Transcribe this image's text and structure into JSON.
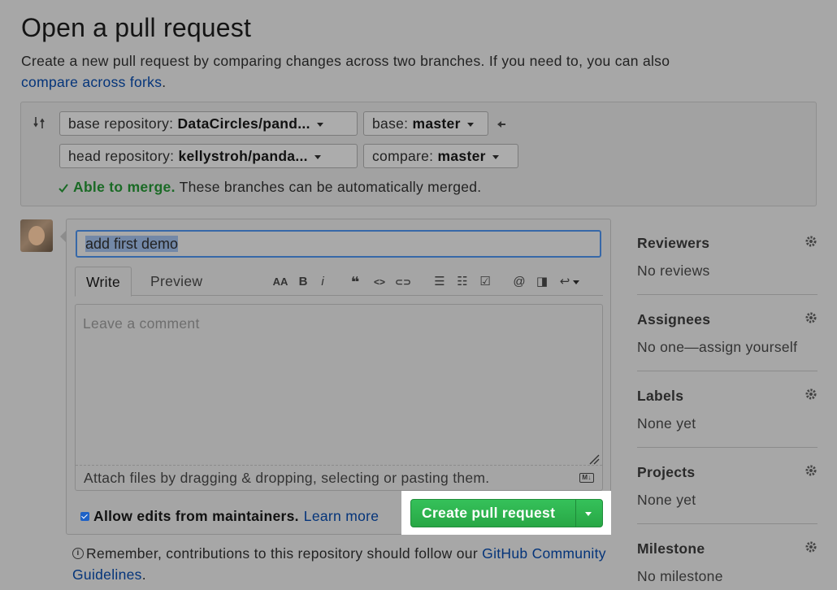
{
  "page": {
    "title": "Open a pull request",
    "subtitle": "Create a new pull request by comparing changes across two branches. If you need to, you can also",
    "subtitle_link": "compare across forks",
    "subtitle_end": "."
  },
  "compare": {
    "base_repo_label": "base repository:",
    "base_repo_value": "DataCircles/pand...",
    "base_label": "base:",
    "base_value": "master",
    "head_repo_label": "head repository:",
    "head_repo_value": "kellystroh/panda...",
    "compare_label": "compare:",
    "compare_value": "master",
    "merge_status": "Able to merge.",
    "merge_detail": "These branches can be automatically merged."
  },
  "composer": {
    "title_value": "add first demo",
    "tabs": [
      {
        "label": "Write"
      },
      {
        "label": "Preview"
      }
    ],
    "toolbar": {
      "heading": "AA",
      "bold": "B",
      "italic": "i",
      "quote": "❝",
      "code": "<>",
      "link": "⊂⊃",
      "ul": "☰",
      "ol": "☷",
      "task": "☑",
      "mention": "@",
      "ref": "◨",
      "reply": "↩"
    },
    "placeholder": "Leave a comment",
    "attach_text": "Attach files by dragging & dropping, selecting or pasting them.",
    "md_badge": "M↓",
    "allow_edits_label": "Allow edits from maintainers.",
    "learn_more": "Learn more",
    "create_button": "Create pull request"
  },
  "reminder": {
    "text": "Remember, contributions to this repository should follow our",
    "link": "GitHub Community Guidelines",
    "end": "."
  },
  "sidebar": [
    {
      "heading": "Reviewers",
      "value": "No reviews"
    },
    {
      "heading": "Assignees",
      "value": "No one—assign yourself"
    },
    {
      "heading": "Labels",
      "value": "None yet"
    },
    {
      "heading": "Projects",
      "value": "None yet"
    },
    {
      "heading": "Milestone",
      "value": "No milestone"
    }
  ],
  "colors": {
    "create_button": "#28a745",
    "link": "#04347a",
    "merge_ok": "#1a6a25"
  }
}
